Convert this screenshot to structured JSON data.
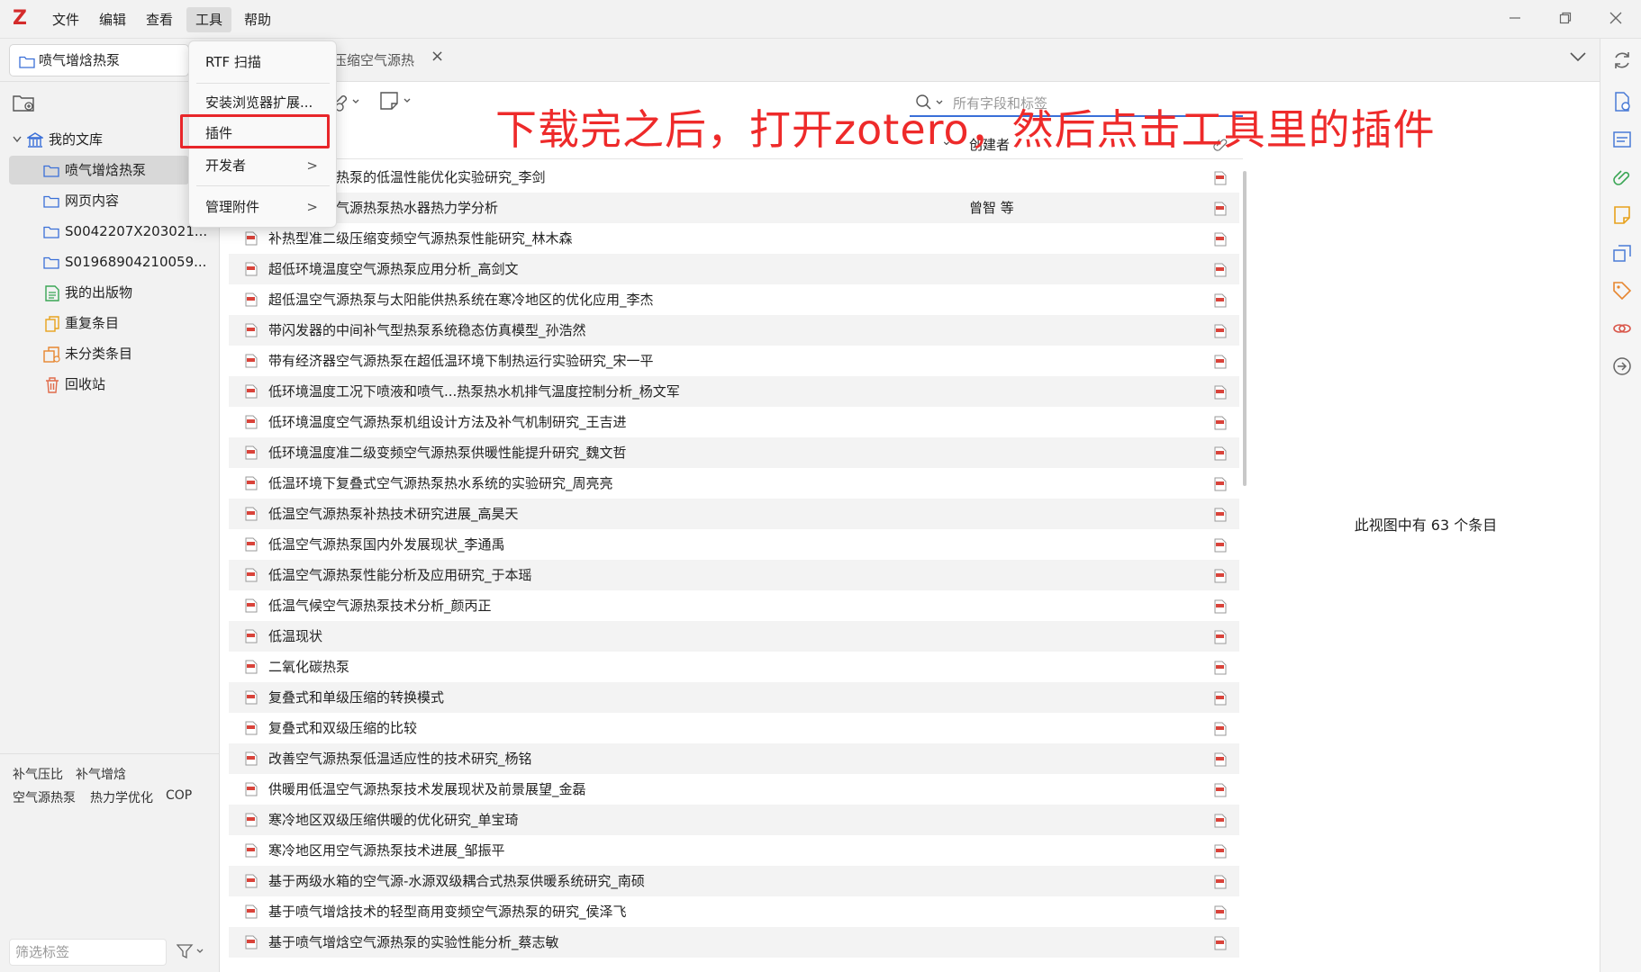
{
  "menubar": {
    "logo": "Z",
    "items": [
      "文件",
      "编辑",
      "查看",
      "工具",
      "帮助"
    ],
    "active": "工具"
  },
  "tabs": {
    "library_tab": "喷气增焓热泵",
    "doc_tab": "压缩空气源热",
    "close": "×"
  },
  "tools_menu": {
    "items": [
      {
        "label": "RTF 扫描"
      },
      {
        "label": "安装浏览器扩展..."
      },
      {
        "label": "插件"
      },
      {
        "label": "开发者",
        "submenu": true
      },
      {
        "label": "管理附件",
        "submenu": true
      }
    ],
    "arrow": ">"
  },
  "sidebar": {
    "library": "我的文库",
    "items": [
      {
        "label": "喷气增焓热泵",
        "icon": "folder-icon"
      },
      {
        "label": "网页内容",
        "icon": "folder-icon"
      },
      {
        "label": "S0042207X203021...",
        "icon": "folder-icon"
      },
      {
        "label": "S01968904210059...",
        "icon": "folder-icon"
      },
      {
        "label": "我的出版物",
        "icon": "publications-icon"
      },
      {
        "label": "重复条目",
        "icon": "duplicate-icon"
      },
      {
        "label": "未分类条目",
        "icon": "unfiled-icon"
      },
      {
        "label": "回收站",
        "icon": "trash-icon"
      }
    ]
  },
  "tags": {
    "items": [
      "补气压比",
      "补气增焓",
      "空气源热泵",
      "热力学优化",
      "COP"
    ],
    "filter_placeholder": "筛选标签"
  },
  "search": {
    "placeholder": "所有字段和标签"
  },
  "columns": {
    "creator": "创建者",
    "sort_mark": "⌄"
  },
  "items": [
    {
      "title": "压缩空气源热泵的低温性能优化实验研究_李剑",
      "creator": ""
    },
    {
      "title": "二级压缩空气源热泵热水器热力学分析",
      "creator": "曾智 等"
    },
    {
      "title": "补热型准二级压缩变频空气源热泵性能研究_林木森",
      "creator": ""
    },
    {
      "title": "超低环境温度空气源热泵应用分析_高剑文",
      "creator": ""
    },
    {
      "title": "超低温空气源热泵与太阳能供热系统在寒冷地区的优化应用_李杰",
      "creator": ""
    },
    {
      "title": "带闪发器的中间补气型热泵系统稳态仿真模型_孙浩然",
      "creator": ""
    },
    {
      "title": "带有经济器空气源热泵在超低温环境下制热运行实验研究_宋一平",
      "creator": ""
    },
    {
      "title": "低环境温度工况下喷液和喷气...热泵热水机排气温度控制分析_杨文军",
      "creator": ""
    },
    {
      "title": "低环境温度空气源热泵机组设计方法及补气机制研究_王吉进",
      "creator": ""
    },
    {
      "title": "低环境温度准二级变频空气源热泵供暖性能提升研究_魏文哲",
      "creator": ""
    },
    {
      "title": "低温环境下复叠式空气源热泵热水系统的实验研究_周亮亮",
      "creator": ""
    },
    {
      "title": "低温空气源热泵补热技术研究进展_高昊天",
      "creator": ""
    },
    {
      "title": "低温空气源热泵国内外发展现状_李通禹",
      "creator": ""
    },
    {
      "title": "低温空气源热泵性能分析及应用研究_于本瑶",
      "creator": ""
    },
    {
      "title": "低温气候空气源热泵技术分析_颜丙正",
      "creator": ""
    },
    {
      "title": "低温现状",
      "creator": ""
    },
    {
      "title": "二氧化碳热泵",
      "creator": ""
    },
    {
      "title": "复叠式和单级压缩的转换模式",
      "creator": ""
    },
    {
      "title": "复叠式和双级压缩的比较",
      "creator": ""
    },
    {
      "title": "改善空气源热泵低温适应性的技术研究_杨铭",
      "creator": ""
    },
    {
      "title": "供暖用低温空气源热泵技术发展现状及前景展望_金磊",
      "creator": ""
    },
    {
      "title": "寒冷地区双级压缩供暖的优化研究_单宝琦",
      "creator": ""
    },
    {
      "title": "寒冷地区用空气源热泵技术进展_邹振平",
      "creator": ""
    },
    {
      "title": "基于两级水箱的空气源-水源双级耦合式热泵供暖系统研究_南硕",
      "creator": ""
    },
    {
      "title": "基于喷气增焓技术的轻型商用变频空气源热泵的研究_侯泽飞",
      "creator": ""
    },
    {
      "title": "基于喷气增焓空气源热泵的实验性能分析_蔡志敏",
      "creator": ""
    }
  ],
  "item_pane": {
    "message": "此视图中有 63 个条目"
  },
  "annotation": {
    "text": "下载完之后，打开zotero，然后点击工具里的插件",
    "color": "#ee2a2a"
  },
  "colors": {
    "accent": "#3a6fd8",
    "highlight": "#e8262a",
    "pdf": "#d9433a",
    "logo": "#d42b2b"
  }
}
